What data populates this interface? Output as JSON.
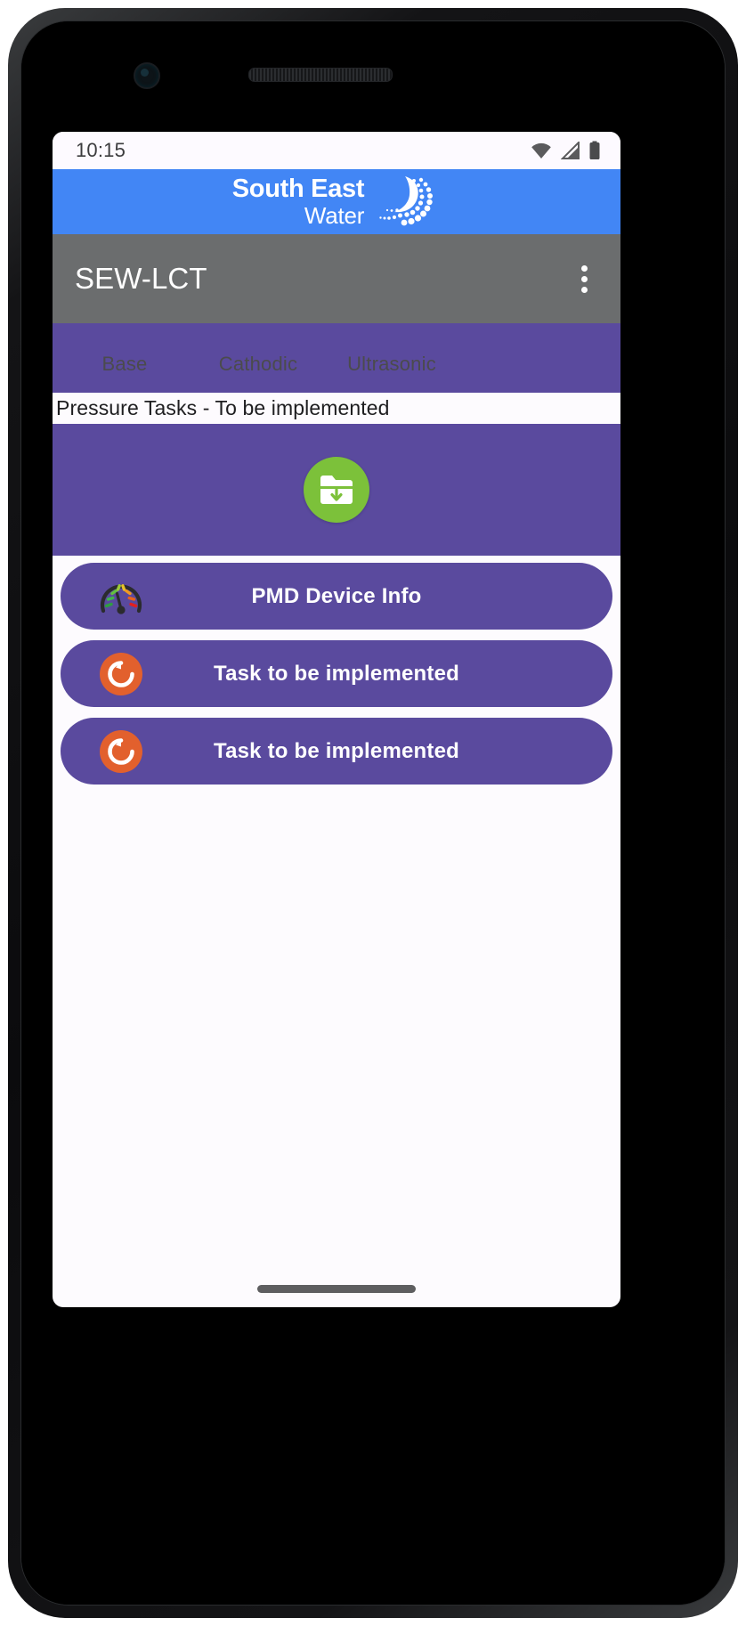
{
  "status_bar": {
    "clock": "10:15",
    "icons": [
      "wifi-icon",
      "cell-signal-icon",
      "battery-icon"
    ]
  },
  "brand_header": {
    "line1": "South East",
    "line2": "Water",
    "logo_icon": "water-swoosh-icon",
    "background_color": "#4286f5"
  },
  "app_bar": {
    "title": "SEW-LCT",
    "overflow_icon": "overflow-menu-icon",
    "background_color": "#6b6d6e"
  },
  "tabs": {
    "items": [
      {
        "label": "Base"
      },
      {
        "label": "Cathodic"
      },
      {
        "label": "Ultrasonic"
      }
    ],
    "background_color": "#5a4a9e",
    "text_color": "#4b4b4d"
  },
  "notice": {
    "text": "Pressure Tasks - To be implemented"
  },
  "download_panel": {
    "fab_icon": "folder-download-icon",
    "fab_color": "#7cc13a",
    "background_color": "#5a4a9e"
  },
  "actions": {
    "rows": [
      {
        "label": "PMD Device Info",
        "icon": "gauge-icon"
      },
      {
        "label": "Task to be implemented",
        "icon": "refresh-circle-icon"
      },
      {
        "label": "Task to be implemented",
        "icon": "refresh-circle-icon"
      }
    ],
    "row_color": "#5a4a9e"
  },
  "gesture_bar": {
    "icon": "home-gesture-pill"
  },
  "device": {
    "camera_icon": "front-camera-icon",
    "earpiece_icon": "earpiece-speaker-icon"
  }
}
